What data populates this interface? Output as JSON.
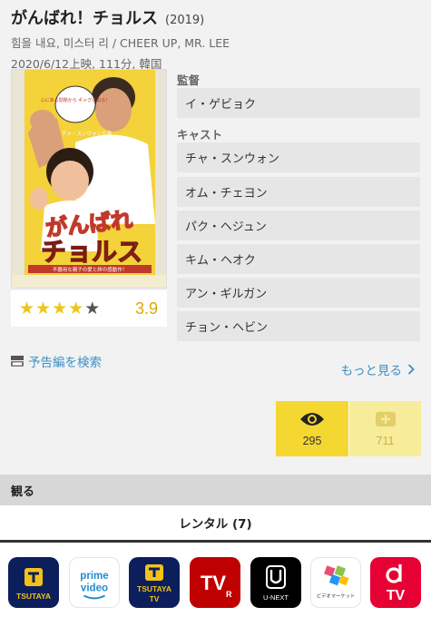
{
  "movie": {
    "title": "がんばれ！チョルス",
    "year": "(2019)",
    "subtitle": "힘을 내요, 미스터 리 / CHEER UP, MR. LEE",
    "meta": "2020/6/12上映, 111分, 韓国",
    "poster": {
      "top_text": "チャ・スンウォン主演",
      "bubble": "心にある問題から ギャグに出る！",
      "title_line1": "がんばれ",
      "title_line2": "チョルス",
      "tagline": "不器用な親子の愛と絆の感動作！"
    }
  },
  "rating": {
    "score": "3.9",
    "value": 3.9,
    "max": 5
  },
  "trailer_label": "予告編を検索",
  "director": {
    "label": "監督",
    "name": "イ・ゲビョク"
  },
  "cast": {
    "label": "キャスト",
    "names": [
      "チャ・スンウォン",
      "オム・チェヨン",
      "パク・ヘジュン",
      "キム・ヘオク",
      "アン・ギルガン",
      "チョン・ヘビン"
    ]
  },
  "more_label": "もっと見る",
  "actions": {
    "watched_count": "295",
    "want_count": "711"
  },
  "watch_section": "観る",
  "rental_label": "レンタル (7)",
  "services": [
    {
      "name": "tsutaya",
      "label": "TSUTAYA",
      "color": "#0c1f5c"
    },
    {
      "name": "prime-video",
      "line1": "prime",
      "line2": "video",
      "color": "#ffffff"
    },
    {
      "name": "tsutaya-tv",
      "label": "TSUTAYA",
      "label2": "TV",
      "color": "#0c1f5c"
    },
    {
      "name": "rakuten-tv",
      "label": "TV",
      "color": "#bf0000"
    },
    {
      "name": "u-next",
      "label": "U-NEXT",
      "color": "#000000"
    },
    {
      "name": "video-market",
      "label": "ビデオマーケット",
      "color": "#ffffff"
    },
    {
      "name": "dtv",
      "label": "TV",
      "color": "#e60033"
    }
  ],
  "colors": {
    "accent_link": "#3a8fc6",
    "star": "#f0c419",
    "score": "#e0a800",
    "watch_bg": "#f5d732",
    "want_bg": "#f6ec9a"
  }
}
